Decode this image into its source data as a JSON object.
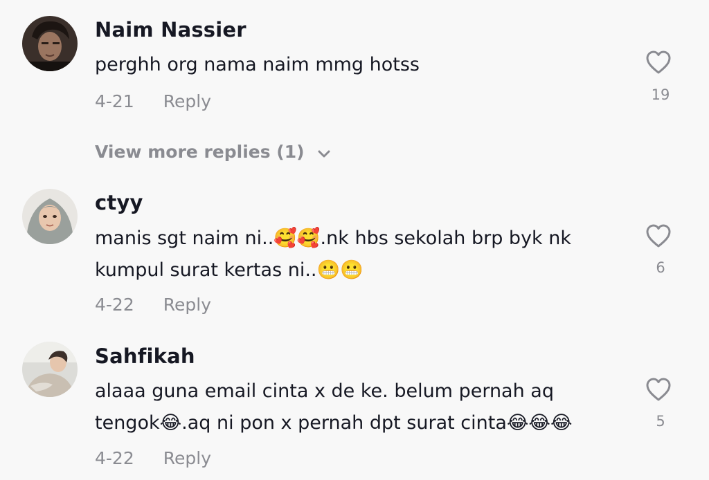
{
  "comments": [
    {
      "username": "Naim Nassier",
      "lines": [
        "perghh org nama naim mmg hotss"
      ],
      "date": "4-21",
      "reply_label": "Reply",
      "likes": "19",
      "avatar": "avatar-naim"
    },
    {
      "username": "ctyy",
      "lines": [
        "manis sgt naim ni..🥰🥰.nk hbs sekolah brp byk nk",
        "kumpul surat kertas ni..😬😬"
      ],
      "date": "4-22",
      "reply_label": "Reply",
      "likes": "6",
      "avatar": "avatar-ctyy"
    },
    {
      "username": "Sahfikah",
      "lines": [
        "alaaa guna email cinta x de ke. belum pernah aq",
        "tengok😂.aq ni pon x pernah dpt surat cinta😂😂😂"
      ],
      "date": "4-22",
      "reply_label": "Reply",
      "likes": "5",
      "avatar": "avatar-sahfikah"
    }
  ],
  "view_more": {
    "label": "View more replies (1)",
    "icon": "chevron-down-icon"
  },
  "icons": {
    "like": "heart-outline-icon"
  },
  "colors": {
    "background": "#f8f8f8",
    "primary_text": "#161823",
    "secondary_text": "#8a8b91"
  }
}
